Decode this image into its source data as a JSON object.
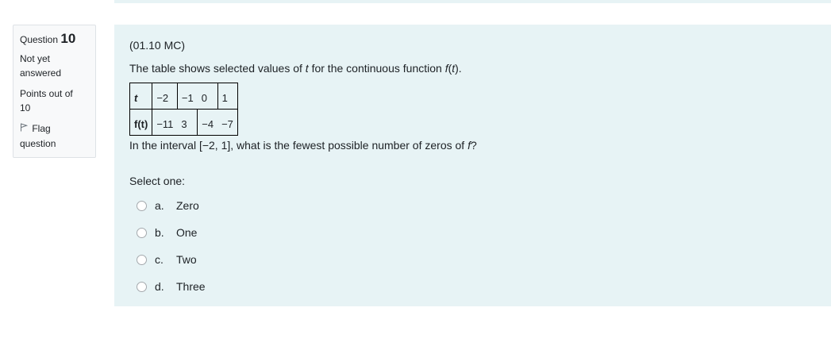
{
  "info": {
    "question_word": "Question",
    "question_number": "10",
    "state_line1": "Not yet",
    "state_line2": "answered",
    "grade_line1": "Points out of",
    "grade_line2": "10",
    "flag_line1": "Flag",
    "flag_line2": "question",
    "flag_icon": "flag-icon"
  },
  "question": {
    "code": "(01.10 MC)",
    "stem_prefix": "The table shows selected values of ",
    "stem_var": "t",
    "stem_middle": " for the continuous function ",
    "stem_fn": "f",
    "stem_fn_paren_open": "(",
    "stem_fn_var": "t",
    "stem_suffix": ").",
    "table": {
      "row1": {
        "head": "t",
        "values": [
          "−2",
          "−1",
          "0",
          "1"
        ]
      },
      "row2": {
        "head": "f(t)",
        "values": [
          "−11",
          "3",
          "−4",
          "−7"
        ]
      }
    },
    "prompt_prefix": "In the interval [−2, 1], what is the fewest possible number of zeros of ",
    "prompt_fn": "f",
    "prompt_suffix": "?",
    "select_label": "Select one:",
    "answers": [
      {
        "letter": "a.",
        "text": "Zero"
      },
      {
        "letter": "b.",
        "text": "One"
      },
      {
        "letter": "c.",
        "text": "Two"
      },
      {
        "letter": "d.",
        "text": "Three"
      }
    ]
  }
}
